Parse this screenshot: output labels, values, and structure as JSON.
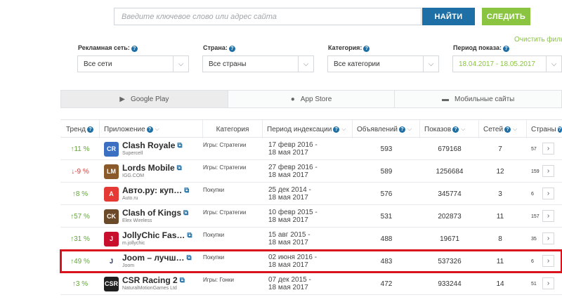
{
  "search": {
    "placeholder": "Введите ключевое слово или адрес сайта",
    "find_label": "НАЙТИ",
    "follow_label": "СЛЕДИТЬ"
  },
  "clear_filters": "Очистить филь",
  "filters": [
    {
      "label": "Рекламная сеть:",
      "value": "Все сети"
    },
    {
      "label": "Страна:",
      "value": "Все страны"
    },
    {
      "label": "Категория:",
      "value": "Все категории"
    },
    {
      "label": "Период показа:",
      "value": "18.04.2017 - 18.05.2017"
    }
  ],
  "tabs": [
    {
      "label": "Google Play",
      "icon": "play-icon"
    },
    {
      "label": "App Store",
      "icon": "apple-icon"
    },
    {
      "label": "Мобильные сайты",
      "icon": "mobile-sites-icon"
    }
  ],
  "columns": {
    "trend": "Тренд",
    "app": "Приложение",
    "category": "Категория",
    "period": "Период индексации",
    "ads": "Объявлений",
    "shows": "Показов",
    "nets": "Сетей",
    "countries": "Страны"
  },
  "rows": [
    {
      "trend": "↑11 %",
      "dir": "up",
      "name": "Clash Royale",
      "dev": "Supercell",
      "category": "Игры: Стратегии",
      "period1": "17 февр 2016 -",
      "period2": "18 мая 2017",
      "ads": "593",
      "shows": "679168",
      "nets": "7",
      "countries": "57",
      "icon_color": "#3b6fc2",
      "icon_text": "CR"
    },
    {
      "trend": "↓-9 %",
      "dir": "down",
      "name": "Lords Mobile",
      "dev": "IGG.COM",
      "category": "Игры: Стратегии",
      "period1": "27 февр 2016 -",
      "period2": "18 мая 2017",
      "ads": "589",
      "shows": "1256684",
      "nets": "12",
      "countries": "159",
      "icon_color": "#8a5a2b",
      "icon_text": "LM"
    },
    {
      "trend": "↑8 %",
      "dir": "up",
      "name": "Авто.ру: куп…",
      "dev": "Auto.ru",
      "category": "Покупки",
      "period1": "25 дек 2014 -",
      "period2": "18 мая 2017",
      "ads": "576",
      "shows": "345774",
      "nets": "3",
      "countries": "6",
      "icon_color": "#e53935",
      "icon_text": "А"
    },
    {
      "trend": "↑57 %",
      "dir": "up",
      "name": "Clash of Kings",
      "dev": "Elex Wireless",
      "category": "Игры: Стратегии",
      "period1": "10 февр 2015 -",
      "period2": "18 мая 2017",
      "ads": "531",
      "shows": "202873",
      "nets": "11",
      "countries": "157",
      "icon_color": "#6b4a2a",
      "icon_text": "CK"
    },
    {
      "trend": "↑31 %",
      "dir": "up",
      "name": "JollyChic Fas…",
      "dev": "m.jollychic",
      "category": "Покупки",
      "period1": "15 авг 2015 -",
      "period2": "18 мая 2017",
      "ads": "488",
      "shows": "19671",
      "nets": "8",
      "countries": "35",
      "icon_color": "#c8102e",
      "icon_text": "J"
    },
    {
      "trend": "↑49 %",
      "dir": "up",
      "name": "Joom – лучш…",
      "dev": "Joom",
      "category": "Покупки",
      "period1": "02 июня 2016 -",
      "period2": "18 мая 2017",
      "ads": "483",
      "shows": "537326",
      "nets": "11",
      "countries": "6",
      "icon_color": "#ffffff",
      "icon_text": "J",
      "highlight": true
    },
    {
      "trend": "↑3 %",
      "dir": "up",
      "name": "CSR Racing 2",
      "dev": "NaturalMotionGames Ltd",
      "category": "Игры: Гонки",
      "period1": "07 дек 2015 -",
      "period2": "18 мая 2017",
      "ads": "472",
      "shows": "933244",
      "nets": "14",
      "countries": "51",
      "icon_color": "#1f1f1f",
      "icon_text": "CSR"
    }
  ]
}
